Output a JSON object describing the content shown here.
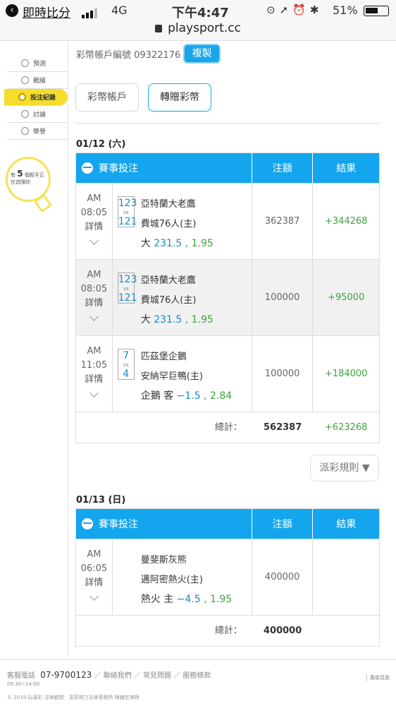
{
  "statusbar": {
    "app": "即時比分",
    "carrier": "4G",
    "time": "下午4:47",
    "battery": "51%"
  },
  "url": "playsport.cc",
  "sidebar": {
    "items": [
      {
        "label": "預測"
      },
      {
        "label": "戰績"
      },
      {
        "label": "投注紀錄"
      },
      {
        "label": "討論"
      },
      {
        "label": "榮譽"
      }
    ],
    "hint_pre": "有",
    "hint_num": "5",
    "hint_post": "個殺手正",
    "hint_line2": "在追隨你"
  },
  "account": {
    "label": "彩幣帳戶編號 09322176",
    "copy_button": "複製"
  },
  "tabs": {
    "wallet": "彩幣帳戶",
    "transfer": "轉贈彩幣"
  },
  "headers": {
    "bets": "賽事投注",
    "amount": "注額",
    "result": "結果"
  },
  "sections": [
    {
      "date": "01/12 (六)",
      "rows": [
        {
          "ampm": "AM",
          "time": "08:05",
          "detail": "詳情",
          "s1": "123",
          "s2": "121",
          "vs": "vs",
          "team1": "亞特蘭大老鷹",
          "team2": "費城76人(主)",
          "pick": "大",
          "line": "231.5",
          "odds": ", 1.95",
          "amount": "362387",
          "result": "+344268"
        },
        {
          "ampm": "AM",
          "time": "08:05",
          "detail": "詳情",
          "s1": "123",
          "s2": "121",
          "vs": "vs",
          "team1": "亞特蘭大老鷹",
          "team2": "費城76人(主)",
          "pick": "大",
          "line": "231.5",
          "odds": ", 1.95",
          "amount": "100000",
          "result": "+95000"
        },
        {
          "ampm": "AM",
          "time": "11:05",
          "detail": "詳情",
          "s1": "7",
          "s2": "4",
          "vs": "vs",
          "team1": "匹茲堡企鵝",
          "team2": "安納罕巨鴨(主)",
          "pick": "企鵝 客",
          "line": "−1.5",
          "odds": ", 2.84",
          "amount": "100000",
          "result": "+184000"
        }
      ],
      "total_label": "總計：",
      "total_amount": "562387",
      "total_result": "+623268"
    },
    {
      "date": "01/13 (日)",
      "rows": [
        {
          "ampm": "AM",
          "time": "06:05",
          "detail": "詳情",
          "team1": "曼斐斯灰熊",
          "team2": "邁阿密熱火(主)",
          "pick": "熱火 主",
          "line": "−4.5",
          "odds": ", 1.95",
          "amount": "400000",
          "result": ""
        }
      ],
      "total_label": "總計：",
      "total_amount": "400000",
      "total_result": ""
    }
  ],
  "rules_button": "派彩規則 ▼",
  "footer": {
    "service_label": "客服電話",
    "hours": "09:30~24:00",
    "phone": "07-9700123",
    "links": "／ 聯絡我們 ／ 常見問題 ／ 服務條款",
    "copyright": "© 2019 玩運彩 法律顧問：漢英得力法律事務所 陳鎮宏律師",
    "right_link": "舊版頁面"
  }
}
